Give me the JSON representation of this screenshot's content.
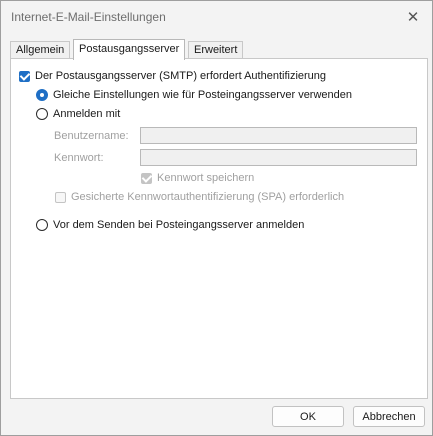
{
  "window": {
    "title": "Internet-E-Mail-Einstellungen",
    "close_glyph": "✕"
  },
  "tabs": [
    {
      "label": "Allgemein",
      "active": false
    },
    {
      "label": "Postausgangsserver",
      "active": true
    },
    {
      "label": "Erweitert",
      "active": false
    }
  ],
  "smtp_auth": {
    "checkbox_label": "Der Postausgangsserver (SMTP) erfordert Authentifizierung",
    "checked": true,
    "same_settings_label": "Gleiche Einstellungen wie für Posteingangsserver verwenden",
    "same_settings_selected": true,
    "login_with_label": "Anmelden mit",
    "login_with_selected": false,
    "username_label": "Benutzername:",
    "username_value": "",
    "password_label": "Kennwort:",
    "password_value": "",
    "remember_password_label": "Kennwort speichern",
    "remember_password_checked": true,
    "spa_label": "Gesicherte Kennwortauthentifizierung (SPA) erforderlich",
    "spa_checked": false,
    "login_before_send_label": "Vor dem Senden bei Posteingangsserver anmelden",
    "login_before_send_selected": false
  },
  "buttons": {
    "ok_label": "OK",
    "cancel_label": "Abbrechen"
  },
  "colors": {
    "accent": "#1f6fc5",
    "dialog_bg": "#f3f3f3",
    "disabled_text": "#a0a0a0"
  }
}
